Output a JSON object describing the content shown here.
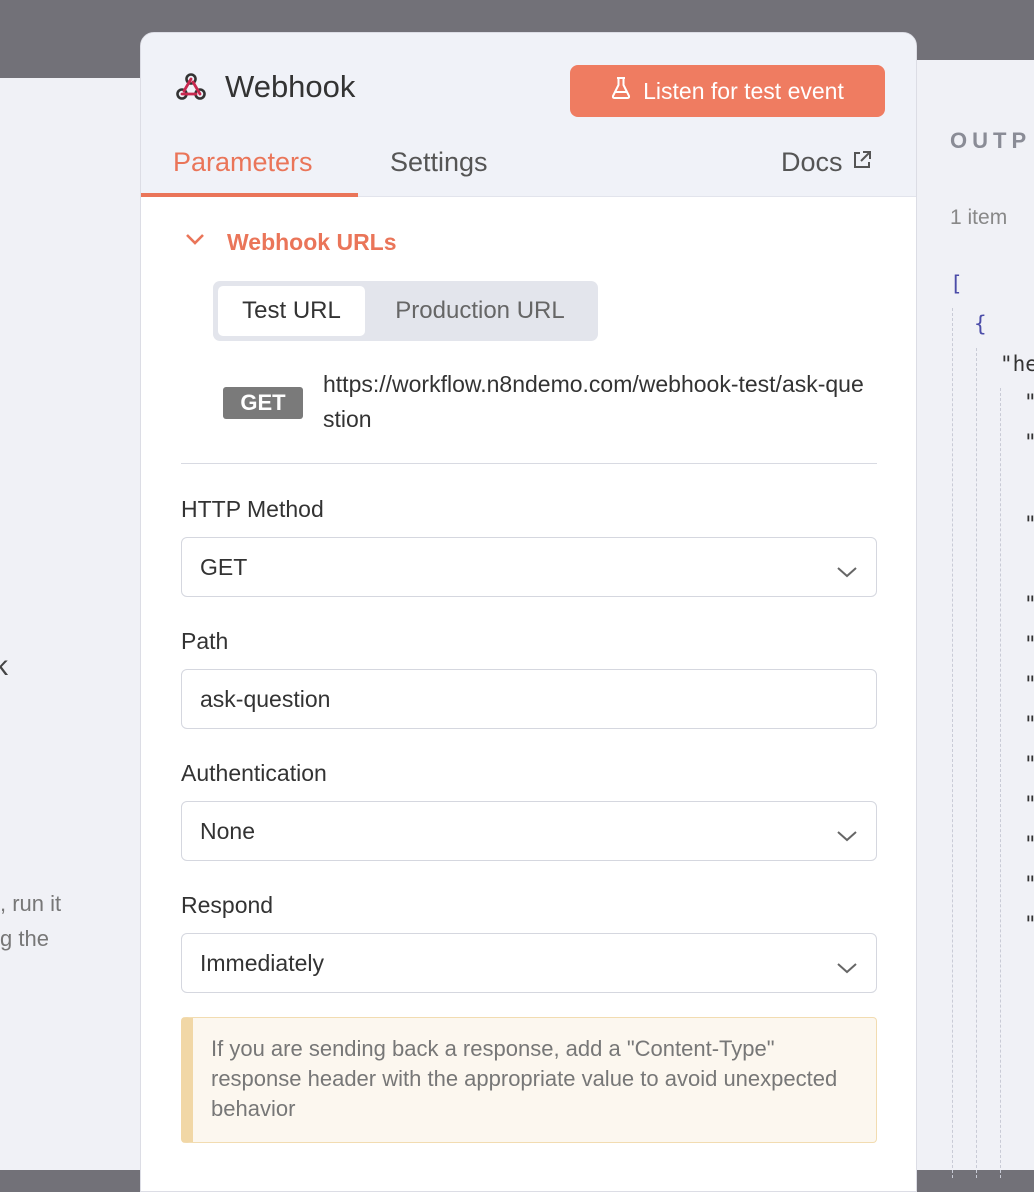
{
  "left_pane": {
    "fragment_k": "k",
    "fragment_text": ", run it\ng the"
  },
  "node": {
    "title": "Webhook",
    "icon": "webhook-icon",
    "listen_button_label": "Listen for test event",
    "listen_button_icon": "flask-icon"
  },
  "tabs": {
    "parameters": "Parameters",
    "settings": "Settings",
    "docs": "Docs"
  },
  "webhook_urls": {
    "section_label": "Webhook URLs",
    "test_url_label": "Test URL",
    "production_url_label": "Production URL",
    "selected": "Test URL",
    "method_badge": "GET",
    "url": "https://workflow.n8ndemo.com/webhook-test/ask-question"
  },
  "fields": {
    "http_method_label": "HTTP Method",
    "http_method_value": "GET",
    "path_label": "Path",
    "path_value": "ask-question",
    "authentication_label": "Authentication",
    "authentication_value": "None",
    "respond_label": "Respond",
    "respond_value": "Immediately"
  },
  "notice": {
    "text": "If you are sending back a response, add a \"Content-Type\" response header with the appropriate value to avoid unexpected behavior"
  },
  "output": {
    "title": "OUTP",
    "item_count": "1 item",
    "json_open_bracket": "[",
    "json_open_brace": "{",
    "json_key_fragment": "\"he",
    "json_quote": "\""
  },
  "colors": {
    "accent": "#ea7559",
    "button": "#ef7c61",
    "backdrop": "#727178",
    "panel": "#f0f1f6"
  }
}
